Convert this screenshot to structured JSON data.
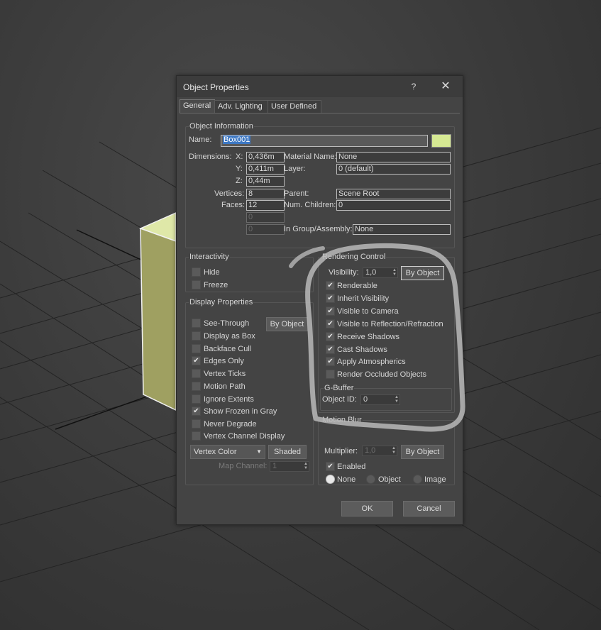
{
  "dialog": {
    "title": "Object Properties",
    "help_label": "?",
    "close_label": "✕"
  },
  "tabs": [
    {
      "label": "General",
      "active": true
    },
    {
      "label": "Adv. Lighting",
      "active": false
    },
    {
      "label": "User Defined",
      "active": false
    }
  ],
  "object_info": {
    "title": "Object Information",
    "name_label": "Name:",
    "name_value": "Box001",
    "color": "#d6e993",
    "dimensions_label": "Dimensions:",
    "x_label": "X:",
    "x_value": "0,436m",
    "y_label": "Y:",
    "y_value": "0,411m",
    "z_label": "Z:",
    "z_value": "0,44m",
    "vertices_label": "Vertices:",
    "vertices_value": "8",
    "faces_label": "Faces:",
    "faces_value": "12",
    "extra1_value": "0",
    "extra2_value": "0",
    "material_label": "Material Name:",
    "material_value": "None",
    "layer_label": "Layer:",
    "layer_value": "0 (default)",
    "parent_label": "Parent:",
    "parent_value": "Scene Root",
    "children_label": "Num. Children:",
    "children_value": "0",
    "group_label": "In Group/Assembly:",
    "group_value": "None"
  },
  "interactivity": {
    "title": "Interactivity",
    "hide_label": "Hide",
    "freeze_label": "Freeze"
  },
  "display": {
    "title": "Display Properties",
    "by_object_label": "By Object",
    "items": [
      {
        "label": "See-Through",
        "checked": false
      },
      {
        "label": "Display as Box",
        "checked": false
      },
      {
        "label": "Backface Cull",
        "checked": false
      },
      {
        "label": "Edges Only",
        "checked": true
      },
      {
        "label": "Vertex Ticks",
        "checked": false
      },
      {
        "label": "Motion Path",
        "checked": false
      },
      {
        "label": "Ignore Extents",
        "checked": false
      },
      {
        "label": "Show Frozen in Gray",
        "checked": true
      },
      {
        "label": "Never Degrade",
        "checked": false
      },
      {
        "label": "Vertex Channel Display",
        "checked": false
      }
    ],
    "vertex_color_label": "Vertex Color",
    "shaded_label": "Shaded",
    "map_channel_label": "Map Channel:",
    "map_channel_value": "1"
  },
  "rendering": {
    "title": "Rendering Control",
    "visibility_label": "Visibility:",
    "visibility_value": "1,0",
    "by_object_label": "By Object",
    "items": [
      {
        "label": "Renderable",
        "checked": true
      },
      {
        "label": "Inherit Visibility",
        "checked": true
      },
      {
        "label": "Visible to Camera",
        "checked": true
      },
      {
        "label": "Visible to Reflection/Refraction",
        "checked": true
      },
      {
        "label": "Receive Shadows",
        "checked": true
      },
      {
        "label": "Cast Shadows",
        "checked": true
      },
      {
        "label": "Apply Atmospherics",
        "checked": true
      },
      {
        "label": "Render Occluded Objects",
        "checked": false
      }
    ],
    "gbuffer_title": "G-Buffer",
    "object_id_label": "Object ID:",
    "object_id_value": "0"
  },
  "motion_blur": {
    "title": "Motion Blur",
    "multiplier_label": "Multiplier:",
    "multiplier_value": "1,0",
    "by_object_label": "By Object",
    "enabled_label": "Enabled",
    "enabled": true,
    "radio": [
      {
        "label": "None",
        "selected": true
      },
      {
        "label": "Object",
        "selected": false
      },
      {
        "label": "Image",
        "selected": false
      }
    ]
  },
  "footer": {
    "ok_label": "OK",
    "cancel_label": "Cancel"
  }
}
